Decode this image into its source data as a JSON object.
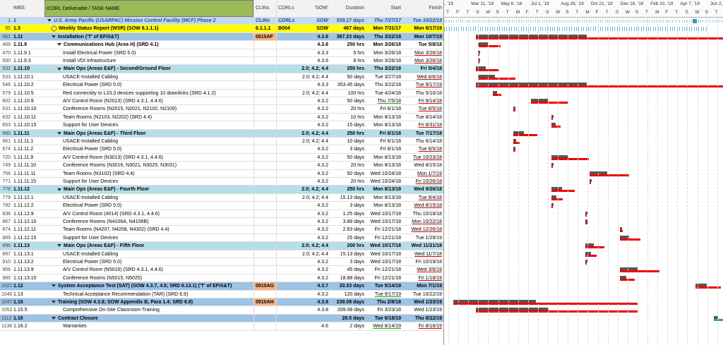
{
  "columns": {
    "wbs": "WBS",
    "name": "ICDRL Deliverable / TASK NAME",
    "clin": "CLINs",
    "cdrl": "CDRLs",
    "sow": "'SOW'",
    "duration": "Duration",
    "start": "Start",
    "finish": "Finish"
  },
  "timeline_top": [
    "'4, '18",
    "Mar 11, '18",
    "May 6, '18",
    "Jul 1, '18",
    "Aug 26, '18",
    "Oct 21, '18",
    "Dec 16, '18",
    "Feb 10, '19",
    "Apr 7, '19",
    "Jun 2, '19"
  ],
  "timeline_days": [
    "T",
    "F",
    "T",
    "S",
    "W",
    "S",
    "T",
    "M",
    "F",
    "T",
    "S",
    "W",
    "S",
    "T",
    "M",
    "F",
    "T",
    "S",
    "W",
    "S",
    "T",
    "M",
    "F",
    "T",
    "S",
    "W",
    "S",
    "T",
    "M"
  ],
  "colors": {
    "yellow": "#ffff00",
    "lightblue": "#b7dde8",
    "midblue": "#9dc3e6",
    "orange": "#f4b183",
    "headerblue": "#c5d9f1",
    "green": "#9bbb59",
    "bar_red": "#e00000",
    "bar_gray": "#555555"
  },
  "rows": [
    {
      "id": "1",
      "wbs": "1",
      "name": "U.S. Army Pacific (USARPAC) Mission Control Facility (MCF) Phase 2",
      "clin": "CLINs",
      "cdrl": "CDRLs",
      "sow": "SOW",
      "duration": "539.17 days",
      "start": "Thu 7/27/17",
      "finish": "Tue 10/22/19",
      "style": "top"
    },
    {
      "id": "95",
      "wbs": "1.3",
      "name": "Weekly Status Report (WSR) (SOW 6.1.1.1)",
      "clin": "6.1.1.1",
      "cdrl": "B004",
      "sow": "SOW",
      "duration": "467 days",
      "start": "Mon 7/31/17",
      "finish": "Mon 6/17/19",
      "style": "yellow"
    },
    {
      "id": "461",
      "wbs": "1.11",
      "name": "Installation ('T' of EFIS&T)",
      "clin": "0010AF",
      "cdrl": "",
      "sow": "4.3.6",
      "duration": "367.23 days",
      "start": "Thu 3/22/18",
      "finish": "Mon 10/7/19",
      "style": "midblue"
    },
    {
      "id": "469",
      "wbs": "1.11.9",
      "name": "Communications Hub (Area H) (SRD 4.1)",
      "clin": "",
      "cdrl": "",
      "sow": "4.3.6",
      "duration": "250 hrs",
      "start": "Mon 3/26/18",
      "finish": "Tue 5/8/18",
      "style": "sum"
    },
    {
      "id": "470",
      "wbs": "1.11.9.1",
      "name": "Install Electrical Power (SRD 5.0)",
      "clin": "",
      "cdrl": "",
      "sow": "4.3.3",
      "duration": "5 hrs",
      "start": "Mon 3/26/18",
      "finish": "Mon 3/26/18",
      "style": "task"
    },
    {
      "id": "500",
      "wbs": "1.11.9.3",
      "name": "Install VDI Infrastructure",
      "clin": "",
      "cdrl": "",
      "sow": "4.3.6",
      "duration": "8 hrs",
      "start": "Mon 3/26/18",
      "finish": "Mon 3/26/18",
      "style": "task"
    },
    {
      "id": "532",
      "wbs": "1.11.10",
      "name": "Main Ops (Areas E&F) - Second/Ground Floor",
      "clin": "",
      "cdrl": "",
      "sow": "2.0; 4.2; 4.4",
      "duration": "250 hrs",
      "start": "Thu 3/22/18",
      "finish": "Fri 5/4/18",
      "style": "lightblue"
    },
    {
      "id": "533",
      "wbs": "1.11.10.1",
      "name": "USACE-Installed Cabling",
      "clin": "",
      "cdrl": "",
      "sow": "2.0; 4.2; 4.4",
      "duration": "50 days",
      "start": "Tue 3/27/18",
      "finish": "Wed 6/6/18",
      "style": "task"
    },
    {
      "id": "546",
      "wbs": "1.11.10.2",
      "name": "Electrical Power (SRD 5.0)",
      "clin": "",
      "cdrl": "",
      "sow": "4.3.3",
      "duration": "353.45 days",
      "start": "Thu 3/22/18",
      "finish": "Tue 9/17/19",
      "style": "task"
    },
    {
      "id": "579",
      "wbs": "1.11.10.5",
      "name": "Red connectiity to L2/L3 devices supporting 10 downlinks (SRD 4.1.2)",
      "clin": "",
      "cdrl": "",
      "sow": "2.0; 4.2; 4.4",
      "duration": "100 hrs",
      "start": "Tue 4/24/18",
      "finish": "Thu 5/10/18",
      "style": "task"
    },
    {
      "id": "602",
      "wbs": "1.11.10.9",
      "name": "A/V Control Room (N2013) (SRD 4.3.1, 4.4.6)",
      "clin": "",
      "cdrl": "",
      "sow": "4.3.2",
      "duration": "50 days",
      "start": "Thu 7/5/18",
      "finish": "Fri 9/14/18",
      "style": "task"
    },
    {
      "id": "631",
      "wbs": "1.11.10.10",
      "name": "Conference Rooms (N2015, N2021, N2102, N2109)",
      "clin": "",
      "cdrl": "",
      "sow": "4.3.2",
      "duration": "20 hrs",
      "start": "Fri 6/1/18",
      "finish": "Tue 6/5/18",
      "style": "task"
    },
    {
      "id": "632",
      "wbs": "1.11.10.11",
      "name": "Team Rooms (N2103, N2202) (SRD 4.4)",
      "clin": "",
      "cdrl": "",
      "sow": "4.3.2",
      "duration": "10 hrs",
      "start": "Mon 8/13/18",
      "finish": "Tue 8/14/18",
      "style": "task"
    },
    {
      "id": "653",
      "wbs": "1.11.10.15",
      "name": "Support for User Devices",
      "clin": "",
      "cdrl": "",
      "sow": "4.3.2",
      "duration": "15 days",
      "start": "Mon 8/13/18",
      "finish": "Fri 8/31/18",
      "style": "task"
    },
    {
      "id": "660",
      "wbs": "1.11.11",
      "name": "Main Ops (Areas E&F) - Third Floor",
      "clin": "",
      "cdrl": "",
      "sow": "2.0; 4.2; 4.4",
      "duration": "250 hrs",
      "start": "Fri 6/1/18",
      "finish": "Tue 7/17/18",
      "style": "lightblue"
    },
    {
      "id": "661",
      "wbs": "1.11.11.1",
      "name": "USACE-Installed Cabling",
      "clin": "",
      "cdrl": "",
      "sow": "2.0; 4.2; 4.4",
      "duration": "10 days",
      "start": "Fri 6/1/18",
      "finish": "Thu 6/14/18",
      "style": "task"
    },
    {
      "id": "674",
      "wbs": "1.11.11.2",
      "name": "Electrical Power (SRD 5.0)",
      "clin": "",
      "cdrl": "",
      "sow": "4.3.2",
      "duration": "3 days",
      "start": "Fri 6/1/18",
      "finish": "Tue 6/5/18",
      "style": "task"
    },
    {
      "id": "720",
      "wbs": "1.11.11.9",
      "name": "A/V Control Room (N3013) (SRD 4.3.1, 4.4.6)",
      "clin": "",
      "cdrl": "",
      "sow": "4.3.2",
      "duration": "50 days",
      "start": "Mon 8/13/18",
      "finish": "Tue 10/23/18",
      "style": "task"
    },
    {
      "id": "749",
      "wbs": "1.11.11.10",
      "name": "Conference Rooms (N3016, N3021, N3025, N3031)",
      "clin": "",
      "cdrl": "",
      "sow": "4.3.2",
      "duration": "20 hrs",
      "start": "Mon 8/13/18",
      "finish": "Wed 8/15/18",
      "style": "task"
    },
    {
      "id": "756",
      "wbs": "1.11.11.11",
      "name": "Team Rooms (N3102) (SRD 4.4)",
      "clin": "",
      "cdrl": "",
      "sow": "4.3.2",
      "duration": "50 days",
      "start": "Wed 10/24/18",
      "finish": "Mon 1/7/19",
      "style": "task"
    },
    {
      "id": "771",
      "wbs": "1.11.11.15",
      "name": "Support for User Devices",
      "clin": "",
      "cdrl": "",
      "sow": "4.3.2",
      "duration": "20 hrs",
      "start": "Wed 10/24/18",
      "finish": "Fri 10/26/18",
      "style": "task"
    },
    {
      "id": "778",
      "wbs": "1.11.12",
      "name": "Main Ops (Areas E&F) - Fourth Floor",
      "clin": "",
      "cdrl": "",
      "sow": "2.0; 4.2; 4.4",
      "duration": "250 hrs",
      "start": "Mon 8/13/18",
      "finish": "Wed 9/26/18",
      "style": "lightblue"
    },
    {
      "id": "779",
      "wbs": "1.11.12.1",
      "name": "USACE-Installed Cabling",
      "clin": "",
      "cdrl": "",
      "sow": "2.0; 4.2; 4.4",
      "duration": "15.13 days",
      "start": "Mon 8/13/18",
      "finish": "Tue 9/4/18",
      "style": "task"
    },
    {
      "id": "792",
      "wbs": "1.11.12.2",
      "name": "Electrical Power (SRD 5.0)",
      "clin": "",
      "cdrl": "",
      "sow": "4.3.2",
      "duration": "3 days",
      "start": "Mon 8/13/18",
      "finish": "Wed 8/15/18",
      "style": "task"
    },
    {
      "id": "838",
      "wbs": "1.11.12.9",
      "name": "A/V Control Room (4014) (SRD 4.3.1, 4.4.6)",
      "clin": "",
      "cdrl": "",
      "sow": "4.3.2",
      "duration": "1.25 days",
      "start": "Wed 10/17/18",
      "finish": "Thu 10/18/18",
      "style": "task"
    },
    {
      "id": "867",
      "wbs": "1.11.12.10",
      "name": "Conference Rooms (N4106A, N4106B)",
      "clin": "",
      "cdrl": "",
      "sow": "4.3.2",
      "duration": "3.88 days",
      "start": "Wed 10/17/18",
      "finish": "Mon 10/22/18",
      "style": "task"
    },
    {
      "id": "874",
      "wbs": "1.11.12.11",
      "name": "Team Rooms (N4207, N4208, N4302) (SRD 4.4)",
      "clin": "",
      "cdrl": "",
      "sow": "4.3.2",
      "duration": "2.63 days",
      "start": "Fri 12/21/18",
      "finish": "Wed 12/26/18",
      "style": "task"
    },
    {
      "id": "889",
      "wbs": "1.11.12.15",
      "name": "Support for User Devices",
      "clin": "",
      "cdrl": "",
      "sow": "4.3.2",
      "duration": "25 days",
      "start": "Fri 12/21/18",
      "finish": "Tue 1/29/19",
      "style": "task"
    },
    {
      "id": "896",
      "wbs": "1.11.13",
      "name": "Main Ops (Areas E&F) - Fifth Floor",
      "clin": "",
      "cdrl": "",
      "sow": "2.0; 4.2; 4.4",
      "duration": "200 hrs",
      "start": "Wed 10/17/18",
      "finish": "Wed 11/21/18",
      "style": "lightblue"
    },
    {
      "id": "897",
      "wbs": "1.11.13.1",
      "name": "USACE-Installed Cabling",
      "clin": "",
      "cdrl": "",
      "sow": "2.0; 4.2; 4.4",
      "duration": "15.13 days",
      "start": "Wed 10/17/18",
      "finish": "Wed 11/7/18",
      "style": "task"
    },
    {
      "id": "910",
      "wbs": "1.11.13.2",
      "name": "Electrical Power (SRD 5.0)",
      "clin": "",
      "cdrl": "",
      "sow": "4.3.2",
      "duration": "3 days",
      "start": "Wed 10/17/18",
      "finish": "Fri 10/19/18",
      "style": "task"
    },
    {
      "id": "956",
      "wbs": "1.11.13.9",
      "name": "A/V Control Room (N5016) (SRD 4.3.1, 4.4.6)",
      "clin": "",
      "cdrl": "",
      "sow": "4.3.2",
      "duration": "45 days",
      "start": "Fri 12/21/18",
      "finish": "Wed 3/6/19",
      "style": "task"
    },
    {
      "id": "985",
      "wbs": "1.11.13.10",
      "name": "Conference Rooms (N5015, N5025)",
      "clin": "",
      "cdrl": "",
      "sow": "4.3.2",
      "duration": "18.88 days",
      "start": "Fri 12/21/18",
      "finish": "Fri 1/18/19",
      "style": "task"
    },
    {
      "id": "1021",
      "wbs": "1.12",
      "name": "System Acceptance Test (SAT) (SOW 4.3.7, 4.5; SRD 6.13.1) ('T' of EFIS&T)",
      "clin": "0010AG",
      "cdrl": "",
      "sow": "4.3.7",
      "duration": "33.33 days",
      "start": "Tue 5/14/19",
      "finish": "Mon 7/1/19",
      "style": "midblue"
    },
    {
      "id": "1040",
      "wbs": "1.13",
      "name": "Technical Acceptance Recommendation (TAR) (SRD 6.9)",
      "clin": "",
      "cdrl": "",
      "sow": "4.3.2",
      "duration": "120 days",
      "start": "Tue 9/17/19",
      "finish": "Tue 10/22/19",
      "style": "plain"
    },
    {
      "id": "1047",
      "wbs": "1.15",
      "name": "Training (SOW 4.3.8; SOW Appendix B, Para 1.4; SRD 6.8)",
      "clin": "0010AH",
      "cdrl": "",
      "sow": "4.3.8",
      "duration": "239.08 days",
      "start": "Thu 2/8/18",
      "finish": "Wed 1/23/19",
      "style": "midblue"
    },
    {
      "id": "1052",
      "wbs": "1.15.5",
      "name": "Comprehensive On-Site Classroom Training",
      "clin": "",
      "cdrl": "",
      "sow": "4.3.8",
      "duration": "209.08 days",
      "start": "Fri 3/23/18",
      "finish": "Wed 1/23/19",
      "style": "task"
    },
    {
      "id": "1112",
      "wbs": "1.16",
      "name": "Contract Closure",
      "clin": "",
      "cdrl": "",
      "sow": "",
      "duration": "28.5 days",
      "start": "Tue 6/18/19",
      "finish": "Thu 8/22/19",
      "style": "midblue"
    },
    {
      "id": "1138",
      "wbs": "1.16.2",
      "name": "Warranties",
      "clin": "",
      "cdrl": "",
      "sow": "4.6",
      "duration": "2 days",
      "start": "Wed 8/14/19",
      "finish": "Fri 8/16/19",
      "style": "task"
    }
  ]
}
